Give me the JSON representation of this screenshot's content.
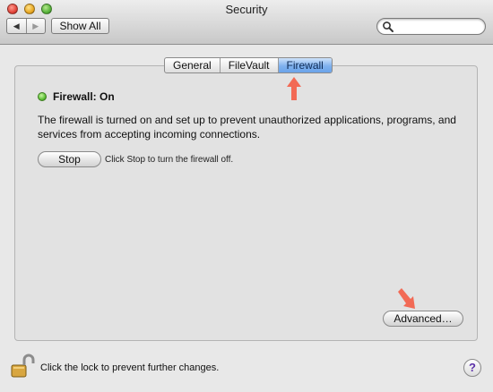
{
  "window": {
    "title": "Security"
  },
  "toolbar": {
    "back_icon": "◀",
    "forward_icon": "▶",
    "show_all_label": "Show All",
    "search_value": "",
    "search_icon": "magnifier-icon"
  },
  "tabs": [
    {
      "label": "General",
      "active": false
    },
    {
      "label": "FileVault",
      "active": false
    },
    {
      "label": "Firewall",
      "active": true
    }
  ],
  "firewall": {
    "status_label": "Firewall: On",
    "status_color": "#5fc13a",
    "description": "The firewall is turned on and set up to prevent unauthorized applications, programs, and services from accepting incoming connections.",
    "stop_button_label": "Stop",
    "stop_hint": "Click Stop to turn the firewall off.",
    "advanced_button_label": "Advanced…"
  },
  "footer": {
    "lock_text": "Click the lock to prevent further changes.",
    "help_label": "?"
  },
  "colors": {
    "annotation_arrow": "#f26a55",
    "active_tab": "#7fb1ee"
  }
}
